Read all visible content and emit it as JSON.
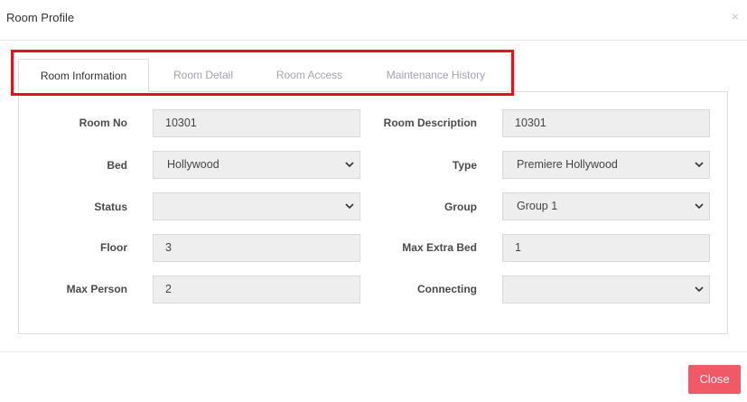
{
  "modal": {
    "title": "Room Profile",
    "close_glyph": "×"
  },
  "tabs": [
    {
      "label": "Room Information",
      "active": true
    },
    {
      "label": "Room Detail",
      "active": false
    },
    {
      "label": "Room Access",
      "active": false
    },
    {
      "label": "Maintenance History",
      "active": false
    }
  ],
  "form": {
    "room_no": {
      "label": "Room No",
      "value": "10301"
    },
    "room_description": {
      "label": "Room Description",
      "value": "10301"
    },
    "bed": {
      "label": "Bed",
      "value": "Hollywood"
    },
    "type": {
      "label": "Type",
      "value": "Premiere Hollywood"
    },
    "status": {
      "label": "Status",
      "value": ""
    },
    "group": {
      "label": "Group",
      "value": "Group 1"
    },
    "floor": {
      "label": "Floor",
      "value": "3"
    },
    "max_extra_bed": {
      "label": "Max Extra Bed",
      "value": "1"
    },
    "max_person": {
      "label": "Max Person",
      "value": "2"
    },
    "connecting": {
      "label": "Connecting",
      "value": ""
    }
  },
  "footer": {
    "close_label": "Close"
  },
  "colors": {
    "highlight": "#e0151c",
    "close_button": "#f05a67",
    "field_bg": "#eeeeee",
    "inactive_tab": "#a2a2b4"
  },
  "icons": {
    "select_arrow": "chevron-down-icon",
    "dismiss": "close-icon"
  }
}
